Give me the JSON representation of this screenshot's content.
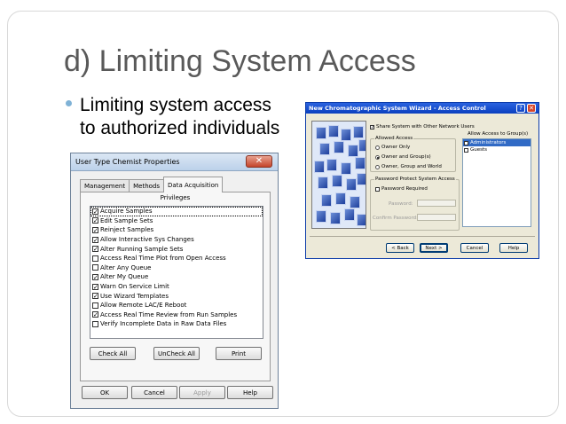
{
  "slide": {
    "title": "d) Limiting System Access",
    "bullet": "Limiting system access to authorized individuals"
  },
  "colors": {
    "bullet": "#7fb2d6",
    "title": "#595959",
    "xp_title": "#0a3fbf",
    "selection": "#316ac5"
  },
  "left_dialog": {
    "title": "User Type Chemist Properties",
    "close_glyph": "✕",
    "tabs": [
      "Management",
      "Methods",
      "Data Acquisition"
    ],
    "active_tab": "Data Acquisition",
    "privileges_label": "Privileges",
    "privileges": [
      {
        "label": "Acquire Samples",
        "checked": true
      },
      {
        "label": "Edit Sample Sets",
        "checked": true
      },
      {
        "label": "Reinject Samples",
        "checked": true
      },
      {
        "label": "Allow Interactive Sys Changes",
        "checked": true
      },
      {
        "label": "Alter Running Sample Sets",
        "checked": true
      },
      {
        "label": "Access Real Time Plot from Open Access",
        "checked": false
      },
      {
        "label": "Alter Any Queue",
        "checked": false
      },
      {
        "label": "Alter My Queue",
        "checked": true
      },
      {
        "label": "Warn On Service Limit",
        "checked": true
      },
      {
        "label": "Use Wizard Templates",
        "checked": true
      },
      {
        "label": "Allow Remote LAC/E Reboot",
        "checked": false
      },
      {
        "label": "Access Real Time Review from Run Samples",
        "checked": true
      },
      {
        "label": "Verify Incomplete Data in Raw Data Files",
        "checked": false
      }
    ],
    "buttons": {
      "check_all": "Check All",
      "uncheck_all": "UnCheck All",
      "print": "Print",
      "ok": "OK",
      "cancel": "Cancel",
      "apply": "Apply",
      "help": "Help"
    }
  },
  "right_dialog": {
    "title": "New Chromatographic System Wizard - Access Control",
    "help_glyph": "?",
    "close_glyph": "✕",
    "share_label": "Share System with Other Network Users",
    "share_checked": true,
    "allowed_access": {
      "title": "Allowed Access",
      "options": [
        "Owner Only",
        "Owner and Group(s)",
        "Owner, Group and World"
      ],
      "selected": "Owner and Group(s)"
    },
    "password": {
      "title": "Password Protect System Access",
      "required_label": "Password Required",
      "required_checked": false,
      "password_label": "Password:",
      "confirm_label": "Confirm Password:"
    },
    "groups": {
      "label": "Allow Access to Group(s)",
      "items": [
        {
          "label": "Administrators",
          "checked": true,
          "selected": true
        },
        {
          "label": "Guests",
          "checked": false,
          "selected": false
        }
      ]
    },
    "buttons": {
      "back": "< Back",
      "next": "Next >",
      "cancel": "Cancel",
      "help": "Help"
    }
  }
}
